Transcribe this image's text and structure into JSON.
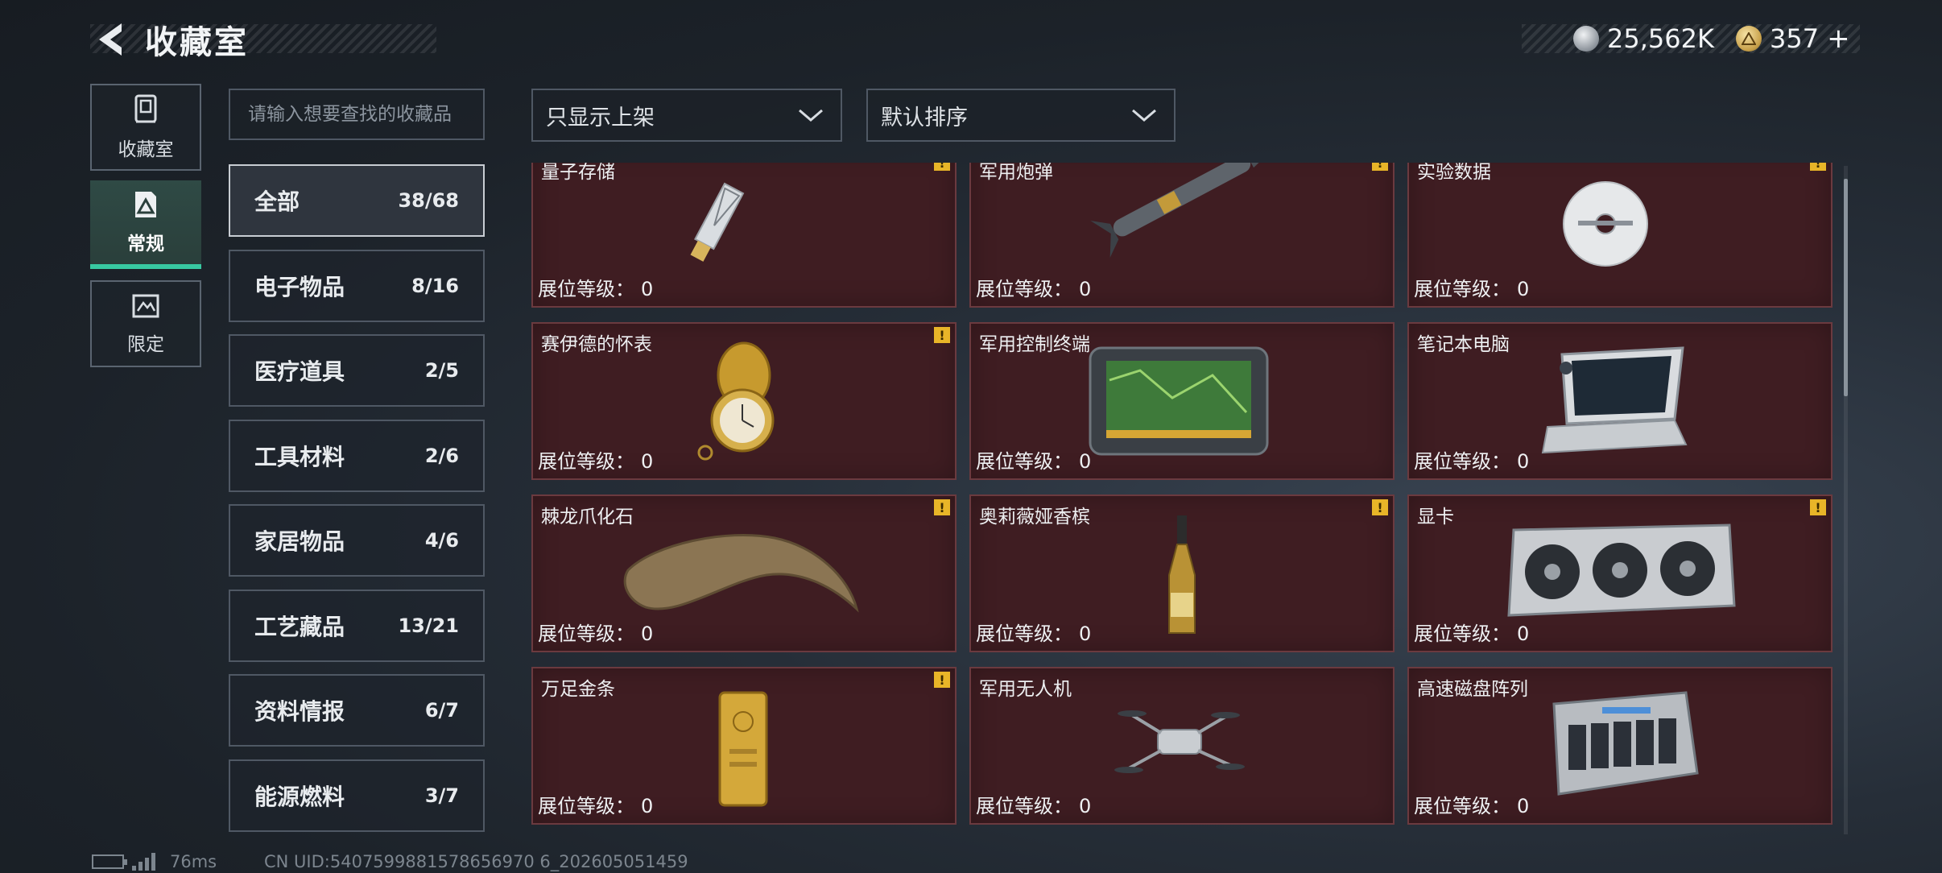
{
  "header": {
    "title": "收藏室"
  },
  "currencies": [
    {
      "icon": "silver-coin-icon",
      "value": "25,562K"
    },
    {
      "icon": "gold-coin-icon",
      "value": "357",
      "add_label": "+"
    }
  ],
  "rail": [
    {
      "label": "收藏室",
      "icon": "collection-room-icon",
      "active": false
    },
    {
      "label": "常规",
      "icon": "regular-icon",
      "active": true
    },
    {
      "label": "限定",
      "icon": "limited-icon",
      "active": false
    }
  ],
  "search": {
    "placeholder": "请输入想要查找的收藏品"
  },
  "categories": [
    {
      "label": "全部",
      "count": "38/68",
      "active": true
    },
    {
      "label": "电子物品",
      "count": "8/16"
    },
    {
      "label": "医疗道具",
      "count": "2/5"
    },
    {
      "label": "工具材料",
      "count": "2/6"
    },
    {
      "label": "家居物品",
      "count": "4/6"
    },
    {
      "label": "工艺藏品",
      "count": "13/21"
    },
    {
      "label": "资料情报",
      "count": "6/7"
    },
    {
      "label": "能源燃料",
      "count": "3/7"
    }
  ],
  "filters": {
    "display_filter": "只显示上架",
    "sort": "默认排序"
  },
  "level_label": "展位等级：",
  "badge_text": "!",
  "items": [
    {
      "name": "量子存储",
      "level": "0",
      "badge": true,
      "icon": "usb-drive-icon"
    },
    {
      "name": "军用炮弹",
      "level": "0",
      "badge": true,
      "icon": "missile-icon"
    },
    {
      "name": "实验数据",
      "level": "0",
      "badge": true,
      "icon": "disc-icon"
    },
    {
      "name": "赛伊德的怀表",
      "level": "0",
      "badge": true,
      "icon": "pocket-watch-icon"
    },
    {
      "name": "军用控制终端",
      "level": "0",
      "badge": false,
      "icon": "control-terminal-icon"
    },
    {
      "name": "笔记本电脑",
      "level": "0",
      "badge": false,
      "icon": "laptop-icon"
    },
    {
      "name": "棘龙爪化石",
      "level": "0",
      "badge": true,
      "icon": "claw-fossil-icon"
    },
    {
      "name": "奥莉薇娅香槟",
      "level": "0",
      "badge": true,
      "icon": "champagne-bottle-icon"
    },
    {
      "name": "显卡",
      "level": "0",
      "badge": true,
      "icon": "graphics-card-icon"
    },
    {
      "name": "万足金条",
      "level": "0",
      "badge": true,
      "icon": "gold-bar-icon"
    },
    {
      "name": "军用无人机",
      "level": "0",
      "badge": false,
      "icon": "drone-icon"
    },
    {
      "name": "高速磁盘阵列",
      "level": "0",
      "badge": false,
      "icon": "disk-array-icon"
    }
  ],
  "footer": {
    "ping": "76ms",
    "uid": "CN UID:5407599881578656970 6_202605051459"
  },
  "colors": {
    "card_bg": "#3f1d22",
    "card_border": "#6b3a3f",
    "accent": "#38c9a1",
    "badge": "#e8b528"
  }
}
